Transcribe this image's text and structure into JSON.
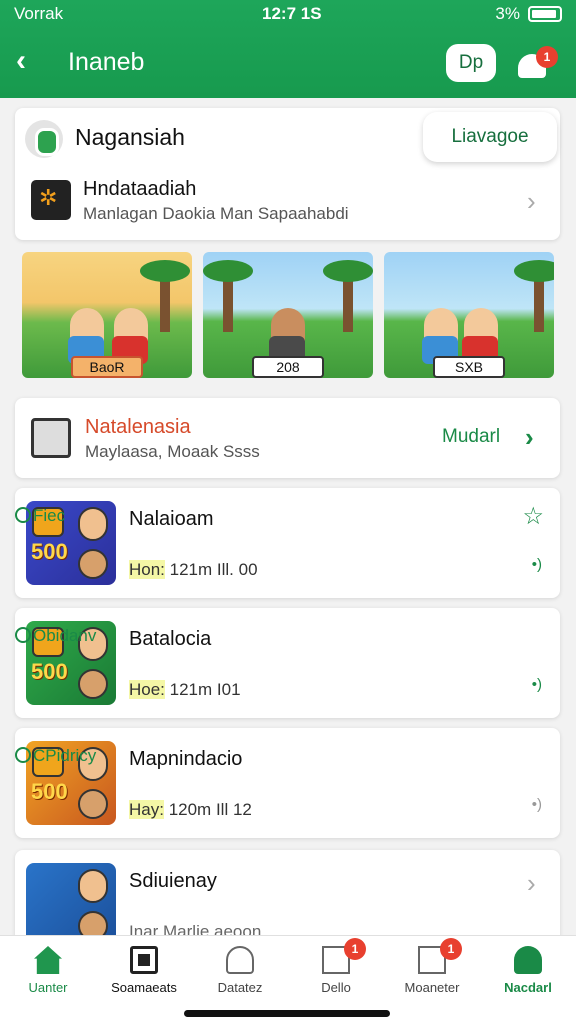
{
  "status_bar": {
    "carrier": "Vorrak",
    "time": "12:7 1S",
    "battery": "3%"
  },
  "header": {
    "title": "Inaneb",
    "back_icon": "chevron-left-icon",
    "action_label": "Dp",
    "notification_badge": "1"
  },
  "top_card": {
    "title": "Nagansiah",
    "pill_label": "Liavagoe",
    "sub_title": "Hndataadiah",
    "sub_subtitle": "Manlagan Daokia Man Sapaahabdi"
  },
  "banners": [
    {
      "label": "BaoR"
    },
    {
      "label": "208"
    },
    {
      "label": "SXB"
    }
  ],
  "promo": {
    "title": "Natalenasia",
    "subtitle": "Maylaasa, Moaak Ssss",
    "action_label": "Mudarl"
  },
  "list": [
    {
      "name": "Nalaioam",
      "highlight": "Hon:",
      "meta": " 121m Ill. 00",
      "status": "Fiec",
      "thumb_num": "500"
    },
    {
      "name": "Batalocia",
      "highlight": "Hoe:",
      "meta": " 121m I01",
      "status": "Obidanv",
      "thumb_num": "500"
    },
    {
      "name": "Mapnindacio",
      "highlight": "Hay:",
      "meta": " 120m Ill 12",
      "status": "CPidricy",
      "thumb_num": "500"
    },
    {
      "name": "Sdiuienay",
      "highlight": "",
      "meta": "Inar Marlie aeoon",
      "status": "",
      "thumb_num": ""
    }
  ],
  "tabs": [
    {
      "label": "Uanter",
      "icon": "home-icon",
      "active": true
    },
    {
      "label": "Soamaeats",
      "icon": "film-icon",
      "active": false
    },
    {
      "label": "Datatez",
      "icon": "person-icon",
      "active": false
    },
    {
      "label": "Dello",
      "icon": "frame-icon",
      "active": false,
      "badge": "1"
    },
    {
      "label": "Moaneter",
      "icon": "chart-icon",
      "active": false,
      "badge": "1"
    },
    {
      "label": "Nacdarl",
      "icon": "profile-icon",
      "active": true
    }
  ],
  "colors": {
    "brand_green": "#1ea65a",
    "accent_red": "#e8402f"
  }
}
